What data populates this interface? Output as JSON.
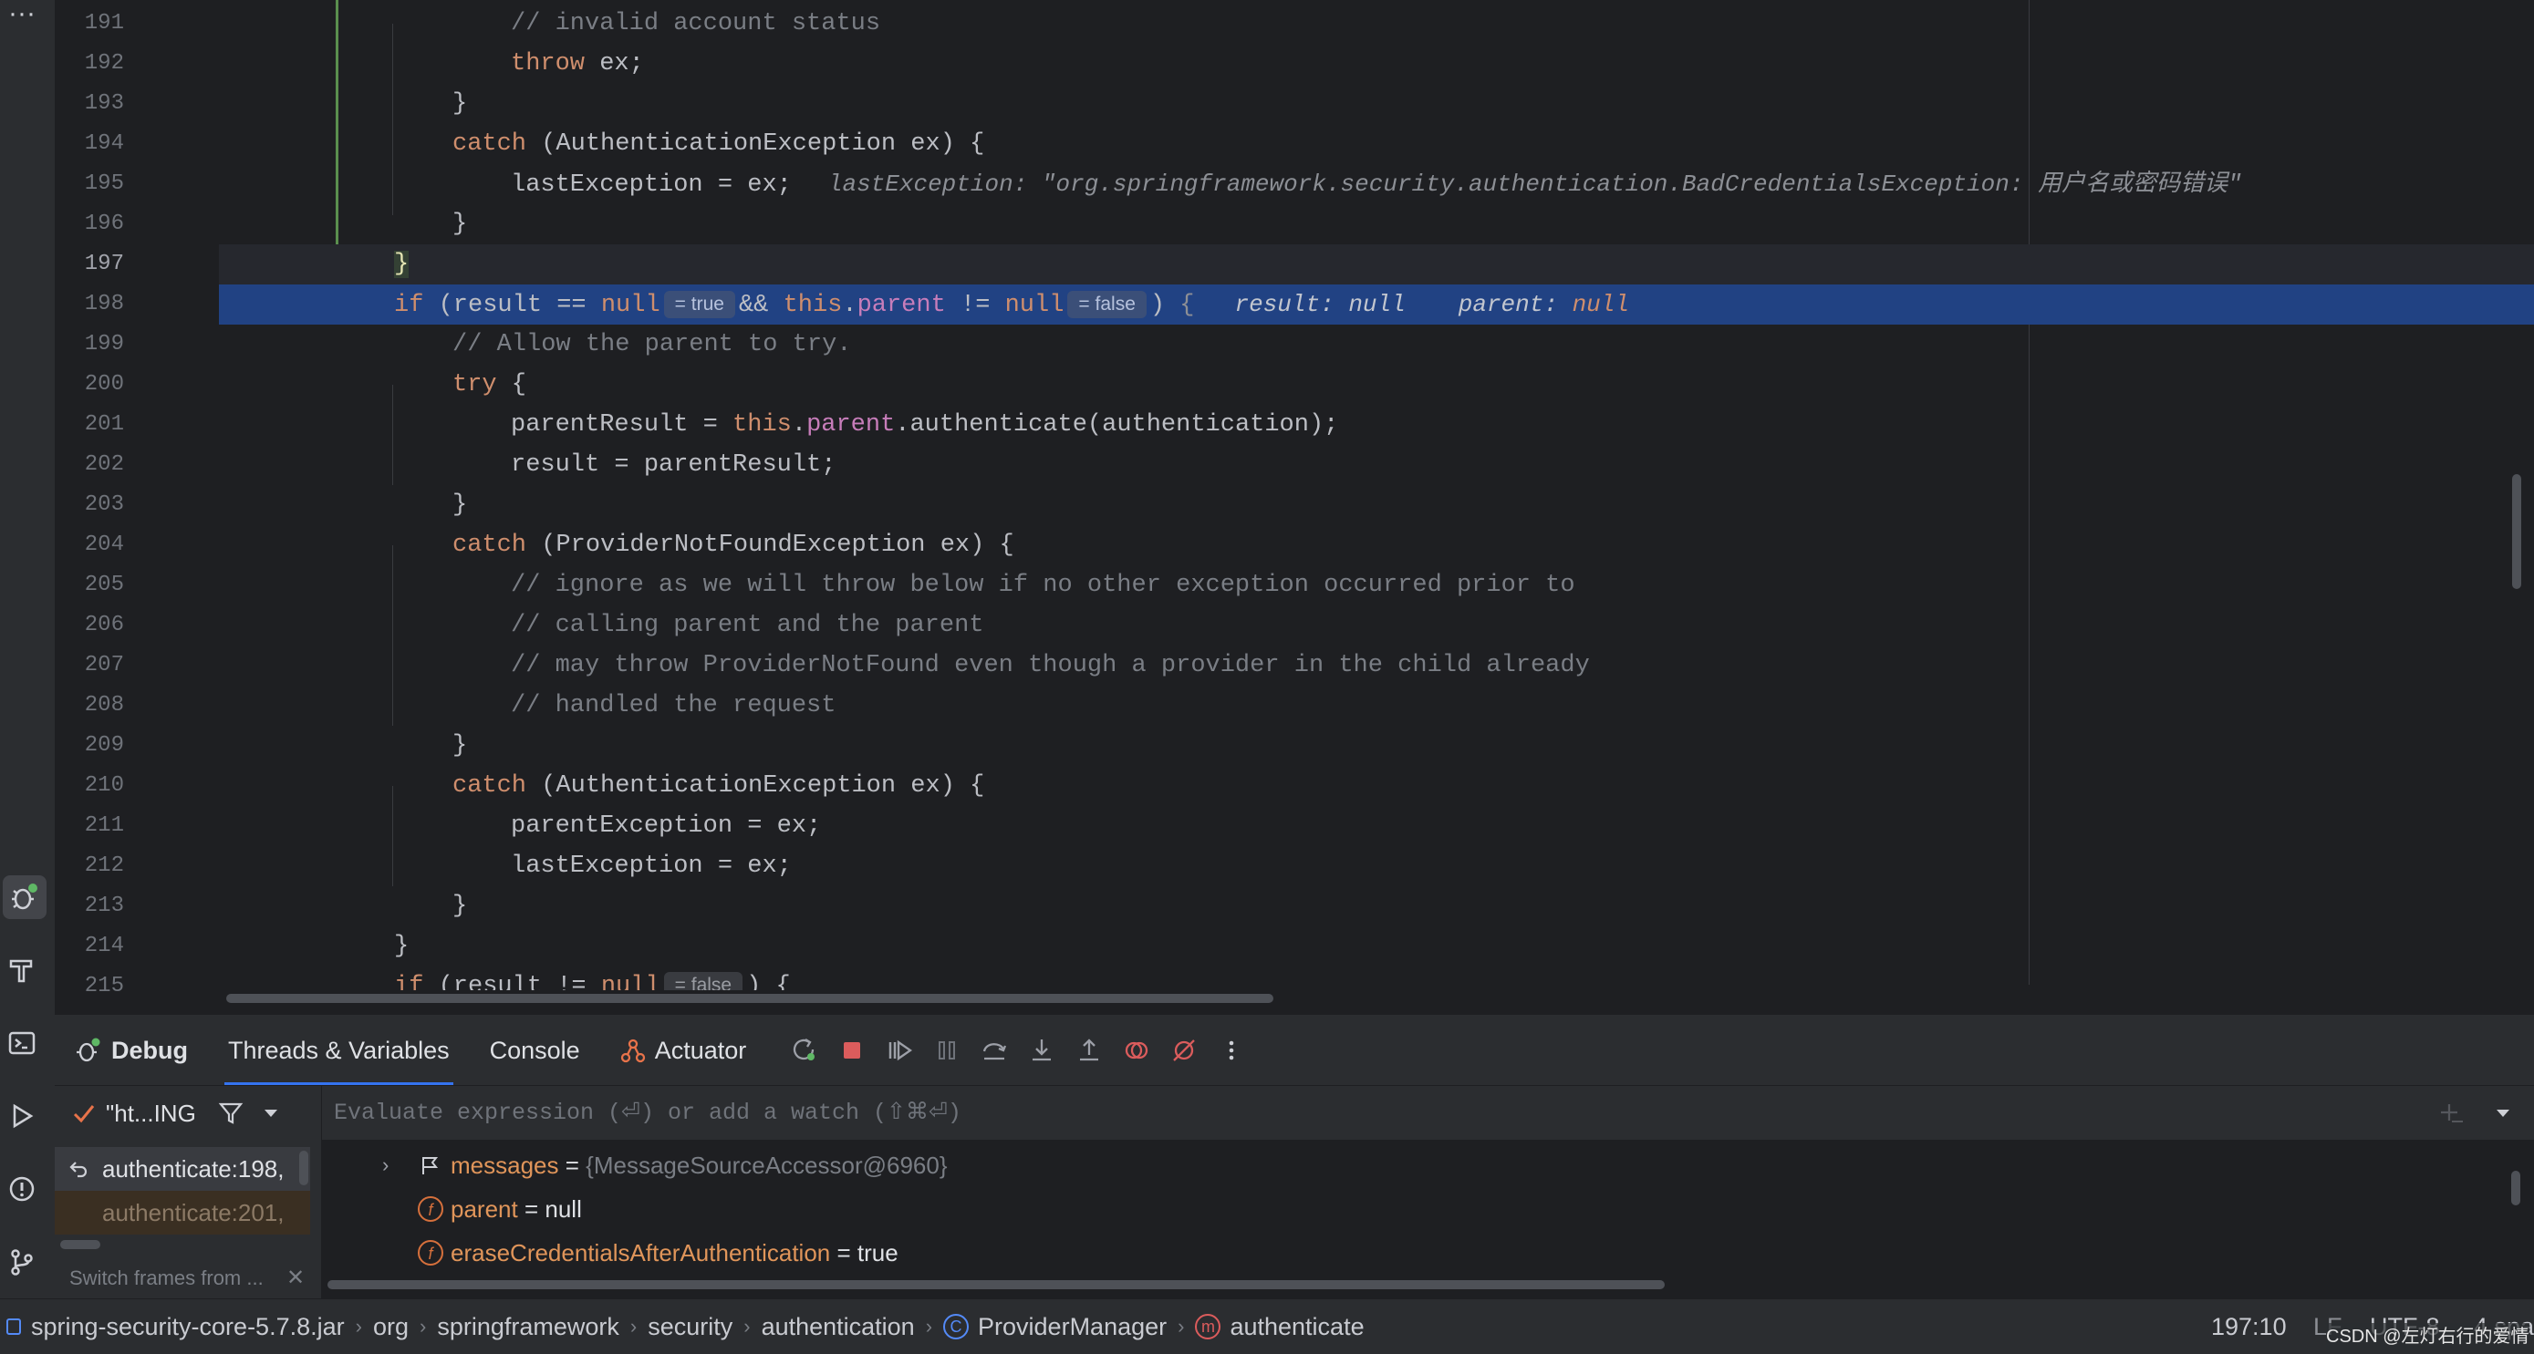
{
  "editor": {
    "lines": [
      {
        "n": "191",
        "text": "// invalid account status"
      },
      {
        "n": "192",
        "text": "throw ex;"
      },
      {
        "n": "193",
        "text": "}"
      },
      {
        "n": "194",
        "text": "catch (AuthenticationException ex) {"
      },
      {
        "n": "195",
        "text": "lastException = ex;"
      },
      {
        "n": "196",
        "text": "}"
      },
      {
        "n": "197",
        "text": "}"
      },
      {
        "n": "198",
        "text": "if (result == null && this.parent != null) {"
      },
      {
        "n": "199",
        "text": "// Allow the parent to try."
      },
      {
        "n": "200",
        "text": "try {"
      },
      {
        "n": "201",
        "text": "parentResult = this.parent.authenticate(authentication);"
      },
      {
        "n": "202",
        "text": "result = parentResult;"
      },
      {
        "n": "203",
        "text": "}"
      },
      {
        "n": "204",
        "text": "catch (ProviderNotFoundException ex) {"
      },
      {
        "n": "205",
        "text": "// ignore as we will throw below if no other exception occurred prior to"
      },
      {
        "n": "206",
        "text": "// calling parent and the parent"
      },
      {
        "n": "207",
        "text": "// may throw ProviderNotFound even though a provider in the child already"
      },
      {
        "n": "208",
        "text": "// handled the request"
      },
      {
        "n": "209",
        "text": "}"
      },
      {
        "n": "210",
        "text": "catch (AuthenticationException ex) {"
      },
      {
        "n": "211",
        "text": "parentException = ex;"
      },
      {
        "n": "212",
        "text": "lastException = ex;"
      },
      {
        "n": "213",
        "text": "}"
      },
      {
        "n": "214",
        "text": "}"
      },
      {
        "n": "215",
        "text": "if (result != null"
      }
    ],
    "inlay_195": "lastException: \"org.springframework.security.authentication.BadCredentialsException: 用户名或密码错误\"",
    "inlay_198_badge1": "= true",
    "inlay_198_badge2": "= false",
    "inlay_198_result_label": "result:",
    "inlay_198_result_val": "null",
    "inlay_198_parent_label": "parent:",
    "inlay_198_parent_val": "null",
    "inlay_215_badge": "= false"
  },
  "debug": {
    "title": "Debug",
    "tabs": [
      "Threads & Variables",
      "Console",
      "Actuator"
    ],
    "eval_placeholder": "Evaluate expression (⏎) or add a watch (⇧⌘⏎)",
    "thread_label": "\"ht...ING",
    "frames": [
      "authenticate:198,",
      "authenticate:201,"
    ],
    "switch_frames": "Switch frames from ...",
    "variables": [
      {
        "name": "messages",
        "eq": " = ",
        "value": "{MessageSourceAccessor@6960}"
      },
      {
        "name": "parent",
        "eq": " = ",
        "value": "null"
      },
      {
        "name": "eraseCredentialsAfterAuthentication",
        "eq": " = ",
        "value": "true"
      }
    ]
  },
  "status": {
    "crumbs": [
      "spring-security-core-5.7.8.jar",
      "org",
      "springframework",
      "security",
      "authentication",
      "ProviderManager",
      "authenticate"
    ],
    "position": "197:10",
    "line_sep": "LF",
    "encoding": "UTF-8",
    "indent": "4 spa",
    "watermark": "CSDN @左灯右行的爱情"
  },
  "icons": {
    "class": "C",
    "method": "m",
    "field": "f"
  }
}
